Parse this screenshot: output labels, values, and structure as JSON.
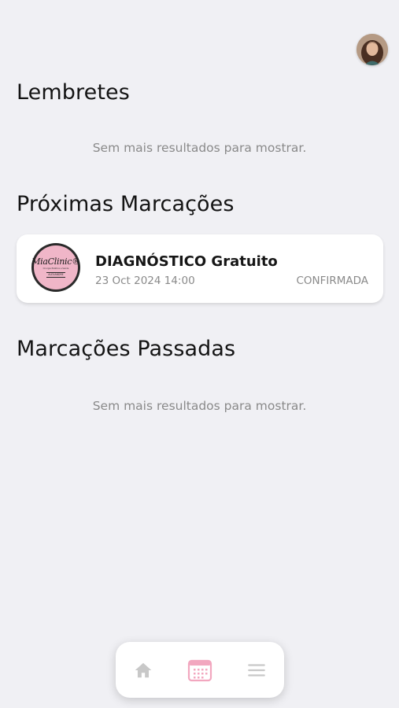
{
  "header": {
    "avatar_icon": "user-avatar"
  },
  "reminders": {
    "title": "Lembretes",
    "empty_text": "Sem mais resultados para mostrar."
  },
  "upcoming": {
    "title": "Próximas Marcações",
    "items": [
      {
        "logo": {
          "brand": "MiaClinic®",
          "tagline": "Cirurgia Estética e Saúde",
          "name": "ALEXANDRE"
        },
        "title": "DIAGNÓSTICO Gratuito",
        "datetime": "23 Oct 2024 14:00",
        "status": "CONFIRMADA"
      }
    ]
  },
  "past": {
    "title": "Marcações Passadas",
    "empty_text": "Sem mais resultados para mostrar."
  },
  "bottom_nav": {
    "items": [
      {
        "icon": "home-icon",
        "active": false
      },
      {
        "icon": "calendar-icon",
        "active": true
      },
      {
        "icon": "menu-icon",
        "active": false
      }
    ]
  },
  "colors": {
    "background": "#f0f0f4",
    "accent": "#f2a7bf",
    "inactive_icon": "#c8c8c8",
    "muted_text": "#8a8a8a"
  }
}
